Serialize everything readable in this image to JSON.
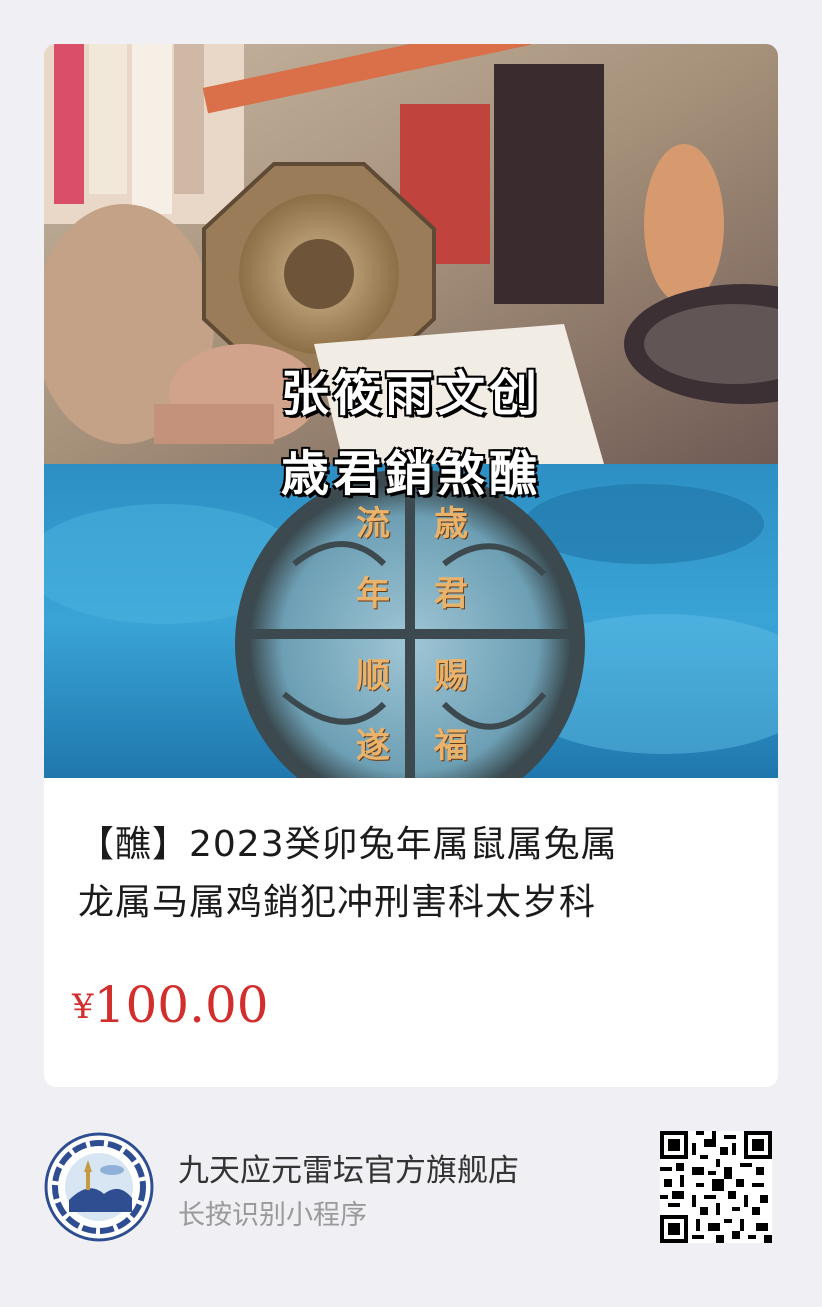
{
  "product": {
    "image_overlay_line1": "张筱雨文创",
    "image_overlay_line2": "歳君銷煞醮",
    "coin_chars": [
      "流",
      "年",
      "顺",
      "遂",
      "歳",
      "君",
      "赐",
      "福"
    ],
    "title_line1": "【醮】2023癸卯兔年属鼠属兔属",
    "title_line2": "龙属马属鸡銷犯冲刑害科太岁科",
    "price_symbol": "¥",
    "price_value": "100.00"
  },
  "shop": {
    "name": "九天应元雷坛官方旗舰店",
    "hint": "长按识别小程序"
  },
  "colors": {
    "price": "#d32e2e",
    "page_background": "#efeff4",
    "card_background": "#ffffff"
  }
}
